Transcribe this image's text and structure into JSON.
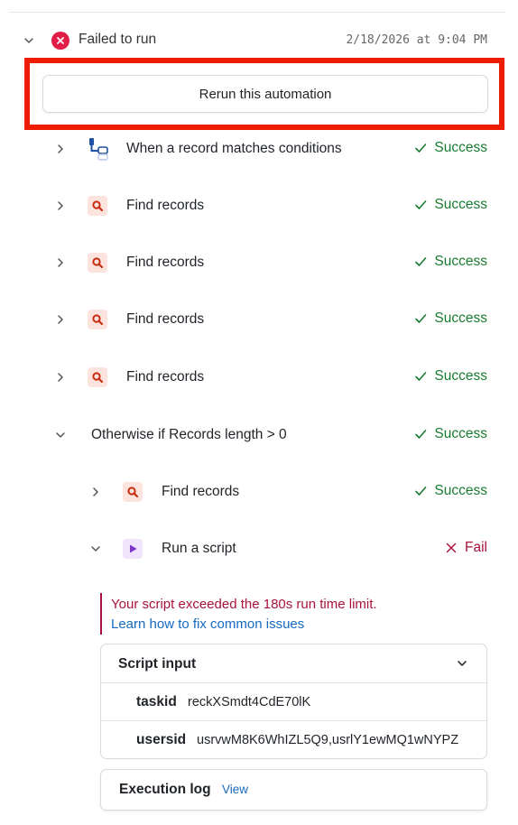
{
  "run": {
    "status_label": "Failed to run",
    "timestamp": "2/18/2026 at 9:04 PM",
    "rerun_label": "Rerun this automation"
  },
  "steps": [
    {
      "label": "When a record matches conditions",
      "status": "Success",
      "icon": "trigger-icon"
    },
    {
      "label": "Find records",
      "status": "Success",
      "icon": "search-icon"
    },
    {
      "label": "Find records",
      "status": "Success",
      "icon": "search-icon"
    },
    {
      "label": "Find records",
      "status": "Success",
      "icon": "search-icon"
    },
    {
      "label": "Find records",
      "status": "Success",
      "icon": "search-icon"
    }
  ],
  "branch": {
    "label": "Otherwise if Records length > 0",
    "status": "Success",
    "steps": [
      {
        "label": "Find records",
        "status": "Success",
        "icon": "search-icon"
      },
      {
        "label": "Run a script",
        "status": "Fail",
        "icon": "play-icon"
      }
    ]
  },
  "error": {
    "message": "Your script exceeded the 180s run time limit.",
    "link_text": "Learn how to fix common issues"
  },
  "script_input": {
    "title": "Script input",
    "rows": [
      {
        "key": "taskid",
        "value": "reckXSmdt4CdE70lK"
      },
      {
        "key": "usersid",
        "value": "usrvwM8K6WhIZL5Q9,usrlY1ewMQ1wNYPZ"
      }
    ]
  },
  "execution_log": {
    "title": "Execution log",
    "view_label": "View"
  },
  "colors": {
    "success": "#187a2f",
    "fail": "#a8123b",
    "link": "#1669c1",
    "highlight": "#ee1c03",
    "find_icon": "#c62d0f",
    "script_icon": "#7b35c8"
  }
}
